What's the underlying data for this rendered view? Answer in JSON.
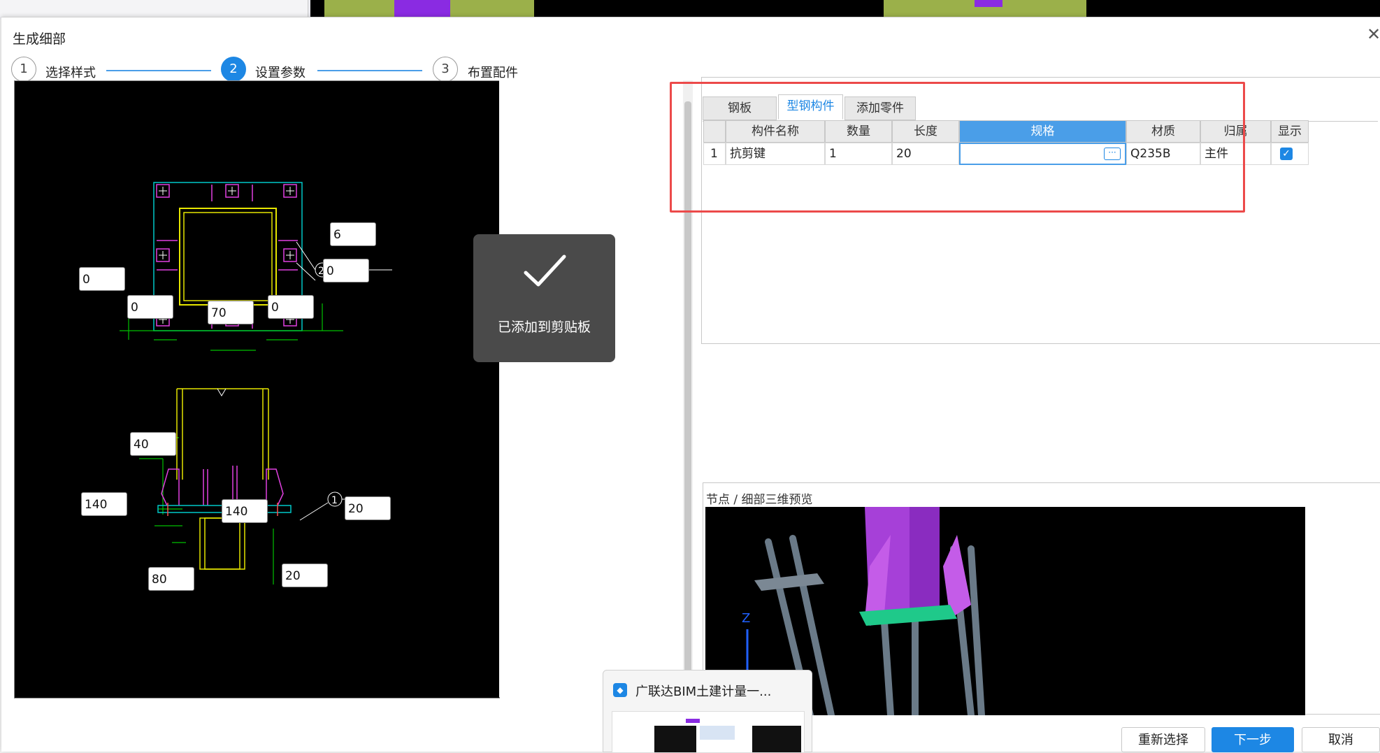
{
  "dialog": {
    "title": "生成细部",
    "close_icon": "close-icon"
  },
  "steps": [
    {
      "number": "1",
      "label": "选择样式"
    },
    {
      "number": "2",
      "label": "设置参数"
    },
    {
      "number": "3",
      "label": "布置配件"
    }
  ],
  "drawing": {
    "params": {
      "p1": "6",
      "p2": "0",
      "p3": "0",
      "p4": "0",
      "p5": "70",
      "p6": "0",
      "p7": "40",
      "p8": "140",
      "p9": "140",
      "p10": "20",
      "p11": "80",
      "p12": "20"
    }
  },
  "toast": {
    "icon": "check-icon",
    "text": "已添加到剪贴板"
  },
  "tabs": [
    "钢板",
    "型钢构件",
    "添加零件"
  ],
  "active_tab": "型钢构件",
  "grid": {
    "headers": [
      "",
      "构件名称",
      "数量",
      "长度",
      "规格",
      "材质",
      "归属",
      "显示"
    ],
    "row": {
      "index": "1",
      "name": "抗剪键",
      "qty": "1",
      "length": "20",
      "spec": "",
      "material": "Q235B",
      "owner": "主件",
      "show": true
    }
  },
  "preview": {
    "title": "节点 / 细部三维预览"
  },
  "taskbar_popup": {
    "title": "广联达BIM土建计量一..."
  },
  "buttons": {
    "reselect": "重新选择",
    "next": "下一步",
    "cancel": "取消"
  },
  "colors": {
    "accent": "#1d87e4",
    "highlight_box": "#ec4a4a"
  }
}
